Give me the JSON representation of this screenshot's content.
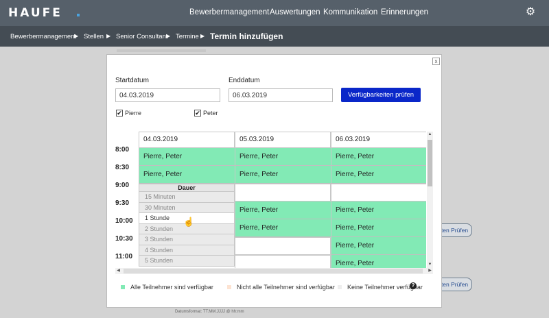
{
  "brand": {
    "logo": "HAUFE"
  },
  "nav": {
    "items": [
      {
        "label": "Bewerbermanagement"
      },
      {
        "label": "Auswertungen"
      },
      {
        "label": "Kommunikation"
      },
      {
        "label": "Erinnerungen"
      }
    ],
    "settings_icon": "gear-icon"
  },
  "breadcrumb": {
    "items": [
      "Bewerbermanagement",
      "Stellen",
      "Senior Consultant",
      "Termine"
    ],
    "current": "Termin hinzufügen",
    "separator": "▶"
  },
  "background": {
    "button_label": "iten Prüfen",
    "date_format_hint": "Datumsformat: TT.MM.JJJJ @ hh:mm"
  },
  "modal": {
    "close_symbol": "x",
    "start_label": "Startdatum",
    "start_value": "04.03.2019",
    "end_label": "Enddatum",
    "end_value": "06.03.2019",
    "check_button": "Verfügbarkeiten prüfen",
    "participants": [
      {
        "name": "Pierre",
        "checked": true
      },
      {
        "name": "Peter",
        "checked": true
      }
    ],
    "times": [
      "8:00",
      "8:30",
      "9:00",
      "9:30",
      "10:00",
      "10:30",
      "11:00"
    ],
    "columns": [
      {
        "date": "04.03.2019",
        "slots": [
          "Pierre, Peter",
          "Pierre, Peter"
        ]
      },
      {
        "date": "05.03.2019",
        "slots": [
          "Pierre, Peter",
          "Pierre, Peter",
          "",
          "Pierre, Peter",
          "Pierre, Peter",
          "",
          ""
        ]
      },
      {
        "date": "06.03.2019",
        "slots": [
          "Pierre, Peter",
          "Pierre, Peter",
          "",
          "Pierre, Peter",
          "Pierre, Peter",
          "Pierre, Peter",
          "Pierre, Peter"
        ]
      }
    ],
    "duration_dropdown": {
      "header": "Dauer",
      "options": [
        "15 Minuten",
        "30 Minuten",
        "1 Stunde",
        "2 Stunden",
        "3 Stunden",
        "4 Stunden",
        "5 Stunden"
      ],
      "hovered": "1 Stunde"
    },
    "legend": {
      "all_available": "Alle Teilnehmer sind verfügbar",
      "some_available": "Nicht alle Teilnehmer sind verfügbar",
      "none_available": "Keine Teilnehmer verfügbar",
      "help_symbol": "?"
    }
  },
  "colors": {
    "available": "#82eab5",
    "partial": "#fde3d2",
    "none": "#eeeeee",
    "primary_button": "#0a27c9",
    "nav_bg": "#56606a",
    "breadcrumb_bg": "#444c54"
  }
}
